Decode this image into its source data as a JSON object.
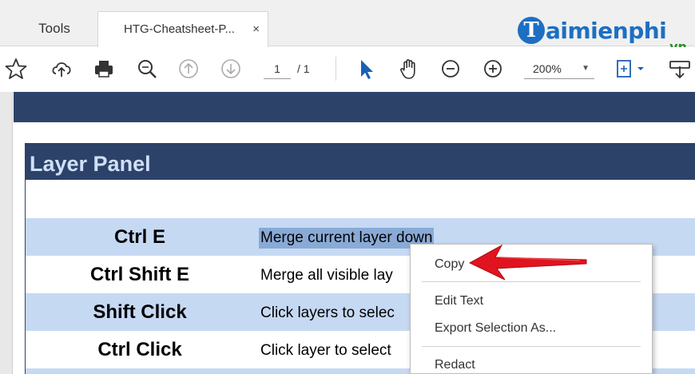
{
  "tabs": {
    "tools_label": "Tools",
    "document_label": "HTG-Cheatsheet-P...",
    "close_glyph": "×"
  },
  "watermark": {
    "badge_letter": "T",
    "text": "aimienphi",
    "suffix": ".vn"
  },
  "toolbar": {
    "page_current": "1",
    "page_total": "/ 1",
    "zoom_value": "200%",
    "zoom_caret": "▼",
    "icons": [
      "star-icon",
      "upload-icon",
      "print-icon",
      "zoom-search-icon",
      "page-up-icon",
      "page-down-icon",
      "select-arrow-icon",
      "hand-icon",
      "zoom-out-icon",
      "zoom-in-icon",
      "fit-page-icon",
      "download-icon"
    ]
  },
  "panel": {
    "title": "Layer Panel",
    "rows": [
      {
        "key": "Ctrl E",
        "desc": "Merge current layer down"
      },
      {
        "key": "Ctrl Shift E",
        "desc": "Merge all visible lay"
      },
      {
        "key": "Shift Click",
        "desc": "Click layers to selec"
      },
      {
        "key": "Ctrl Click",
        "desc": "Click layer to select"
      }
    ]
  },
  "context_menu": {
    "items": [
      "Copy",
      "Edit Text",
      "Export Selection As...",
      "Redact"
    ]
  },
  "colors": {
    "header_navy": "#2d4268",
    "row_shade": "#c6d9f3",
    "selection": "#8aaad6",
    "arrow_red": "#e0141e",
    "brand_blue": "#1d6fc2"
  }
}
